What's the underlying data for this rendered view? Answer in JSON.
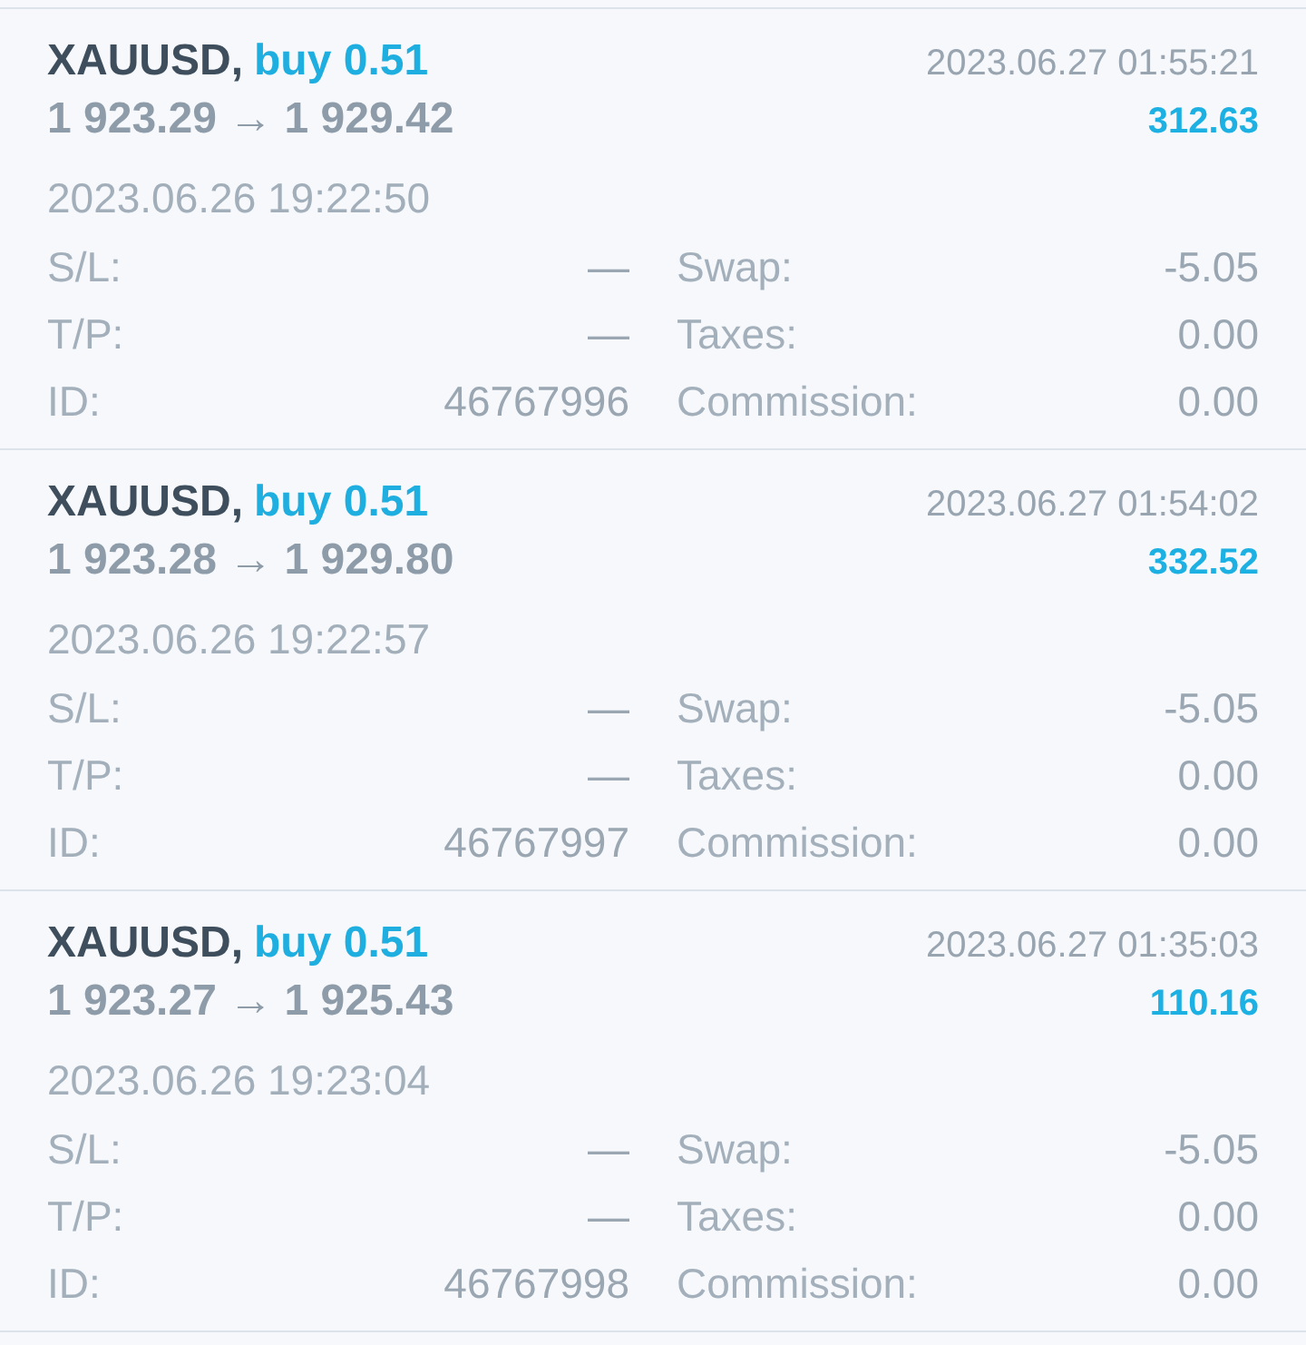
{
  "positions": [
    {
      "symbol": "XAUUSD,",
      "order": "buy 0.51",
      "prices": "1 923.29 → 1 929.42",
      "close_time": "2023.06.27 01:55:21",
      "profit": "312.63",
      "open_time": "2023.06.26 19:22:50",
      "fields": [
        {
          "label": "S/L:",
          "value": "—"
        },
        {
          "label": "Swap:",
          "value": "-5.05"
        },
        {
          "label": "T/P:",
          "value": "—"
        },
        {
          "label": "Taxes:",
          "value": "0.00"
        },
        {
          "label": "ID:",
          "value": "46767996"
        },
        {
          "label": "Commission:",
          "value": "0.00"
        }
      ]
    },
    {
      "symbol": "XAUUSD,",
      "order": "buy 0.51",
      "prices": "1 923.28 → 1 929.80",
      "close_time": "2023.06.27 01:54:02",
      "profit": "332.52",
      "open_time": "2023.06.26 19:22:57",
      "fields": [
        {
          "label": "S/L:",
          "value": "—"
        },
        {
          "label": "Swap:",
          "value": "-5.05"
        },
        {
          "label": "T/P:",
          "value": "—"
        },
        {
          "label": "Taxes:",
          "value": "0.00"
        },
        {
          "label": "ID:",
          "value": "46767997"
        },
        {
          "label": "Commission:",
          "value": "0.00"
        }
      ]
    },
    {
      "symbol": "XAUUSD,",
      "order": "buy 0.51",
      "prices": "1 923.27 → 1 925.43",
      "close_time": "2023.06.27 01:35:03",
      "profit": "110.16",
      "open_time": "2023.06.26 19:23:04",
      "fields": [
        {
          "label": "S/L:",
          "value": "—"
        },
        {
          "label": "Swap:",
          "value": "-5.05"
        },
        {
          "label": "T/P:",
          "value": "—"
        },
        {
          "label": "Taxes:",
          "value": "0.00"
        },
        {
          "label": "ID:",
          "value": "46767998"
        },
        {
          "label": "Commission:",
          "value": "0.00"
        }
      ]
    }
  ]
}
